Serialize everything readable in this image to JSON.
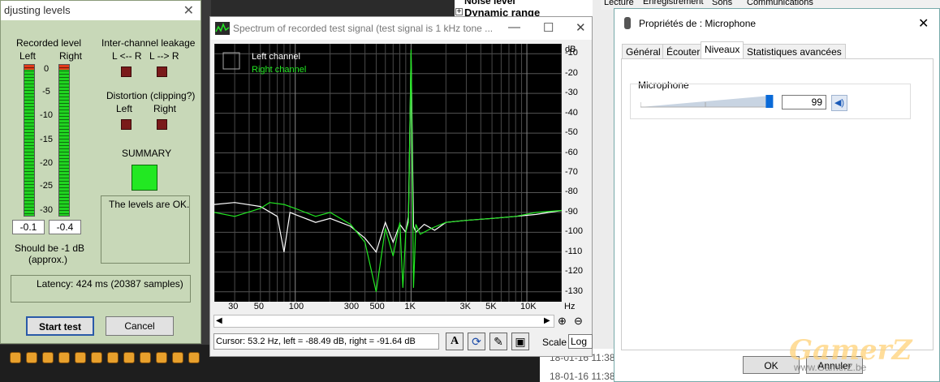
{
  "levels": {
    "title": "djusting levels",
    "recorded_level": "Recorded level",
    "left": "Left",
    "right": "Right",
    "ticks": [
      "0",
      "-5",
      "-10",
      "-15",
      "-20",
      "-25",
      "-30"
    ],
    "left_value": "-0.1",
    "right_value": "-0.4",
    "should_be": "Should be  -1 dB",
    "approx": "(approx.)",
    "leakage_title": "Inter-channel leakage",
    "leak_l": "L <-- R",
    "leak_r": "L --> R",
    "distortion": "Distortion (clipping?)",
    "dist_left": "Left",
    "dist_right": "Right",
    "summary": "SUMMARY",
    "summary_text": "The levels are OK.",
    "latency": "Latency: 424 ms (20387 samples)",
    "start_button": "Start test",
    "cancel_button": "Cancel"
  },
  "spectrum": {
    "title": "Spectrum of recorded test signal (test signal is 1 kHz tone ...",
    "legend_left": "Left channel",
    "legend_right": "Right channel",
    "status": "Cursor:  53.2 Hz,  left = -88.49 dB,  right = -91.64 dB",
    "scale_label": "Scale",
    "scale_value": "Log"
  },
  "chart_data": {
    "type": "line",
    "xscale": "log",
    "x_ticks": [
      "30",
      "50",
      "100",
      "300",
      "500",
      "1K",
      "3K",
      "5K",
      "10K"
    ],
    "x_tick_values": [
      30,
      50,
      100,
      300,
      500,
      1000,
      3000,
      5000,
      10000
    ],
    "x_unit": "Hz",
    "y_unit": "dB",
    "y_ticks": [
      "-10",
      "-20",
      "-30",
      "-40",
      "-50",
      "-60",
      "-70",
      "-80",
      "-90",
      "-100",
      "-110",
      "-120",
      "-130"
    ],
    "ylim": [
      -135,
      -5
    ],
    "xlim": [
      20,
      20000
    ],
    "series": [
      {
        "name": "Left channel",
        "color": "#ffffff",
        "x": [
          20,
          30,
          50,
          70,
          80,
          90,
          110,
          150,
          200,
          300,
          400,
          500,
          600,
          700,
          800,
          900,
          950,
          1000,
          1050,
          1100,
          1300,
          1600,
          2000,
          3000,
          5000,
          8000,
          12000,
          20000
        ],
        "y": [
          -86,
          -85,
          -87,
          -92,
          -110,
          -90,
          -92,
          -95,
          -93,
          -97,
          -103,
          -110,
          -95,
          -105,
          -96,
          -100,
          -92,
          -10,
          -97,
          -100,
          -96,
          -99,
          -95,
          -94,
          -93,
          -92,
          -91,
          -89
        ]
      },
      {
        "name": "Right channel",
        "color": "#22e822",
        "x": [
          20,
          30,
          50,
          60,
          80,
          100,
          150,
          200,
          300,
          400,
          500,
          600,
          700,
          800,
          850,
          900,
          950,
          1000,
          1050,
          1100,
          1200,
          1500,
          2000,
          3000,
          5000,
          8000,
          12000,
          20000
        ],
        "y": [
          -90,
          -92,
          -88,
          -85,
          -86,
          -88,
          -92,
          -90,
          -96,
          -105,
          -130,
          -98,
          -112,
          -95,
          -128,
          -100,
          -95,
          -8,
          -128,
          -96,
          -101,
          -98,
          -95,
          -94,
          -93,
          -92,
          -90,
          -89
        ]
      }
    ]
  },
  "mic": {
    "title": "Propriétés de : Microphone",
    "tabs": [
      "Général",
      "Écouter",
      "Niveaux",
      "Statistiques avancées"
    ],
    "group_label": "Microphone",
    "volume": "99",
    "volume_level": 0.99,
    "ok": "OK",
    "cancel": "Annuler"
  },
  "background": {
    "tree_item1": "Noise level",
    "tree_item2": "Dynamic range",
    "top_tabs": [
      "Lecture",
      "Enregistrement",
      "Sons",
      "Communications"
    ],
    "list_date1": "18-01-16 11:38",
    "list_date2": "18-01-16 11:38",
    "watermark": "GamerZ",
    "watermark_url": "www.GamerZ.be"
  }
}
